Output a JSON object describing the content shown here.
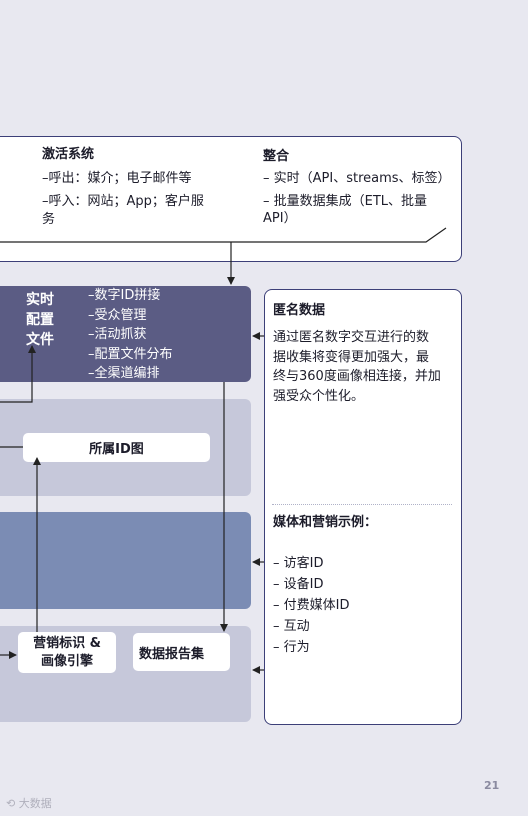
{
  "top_box": {
    "activation": {
      "title": "激活系统",
      "lines": [
        "–呼出：媒介；电子邮件等",
        "–呼入：网站；App；客户服",
        "务"
      ]
    },
    "integration": {
      "title": "整合",
      "lines": [
        "– 实时（API、streams、标签）",
        "– 批量数据集成（ETL、批量",
        "API）"
      ]
    }
  },
  "profile": {
    "title_lines": [
      "实时",
      "配置",
      "文件"
    ],
    "items": [
      "–数字ID拼接",
      "–受众管理",
      "–活动抓获",
      "–配置文件分布",
      "–全渠道编排"
    ]
  },
  "identity_graph": {
    "label": "所属ID图"
  },
  "marketing_tag": {
    "label_lines": [
      "营销标识 &",
      "画像引擎"
    ]
  },
  "report_set": {
    "label": "数据报告集"
  },
  "right_panel": {
    "anonymous": {
      "title": "匿名数据",
      "body_lines": [
        "通过匿名数字交互进行的数",
        "据收集将变得更加强大，最",
        "终与360度画像相连接，并加",
        "强受众个性化。"
      ]
    },
    "media": {
      "title": "媒体和营销示例：",
      "items": [
        "– 访客ID",
        "– 设备ID",
        "– 付费媒体ID",
        "– 互动",
        "– 行为"
      ]
    }
  },
  "footer": {
    "page_number": "21",
    "watermark": "大数据"
  },
  "colors": {
    "background": "#e8e8f0",
    "profile_band": "#5b5c84",
    "light_band": "#c6c8da",
    "mid_band": "#7b8cb4",
    "border": "#3c3f78"
  }
}
